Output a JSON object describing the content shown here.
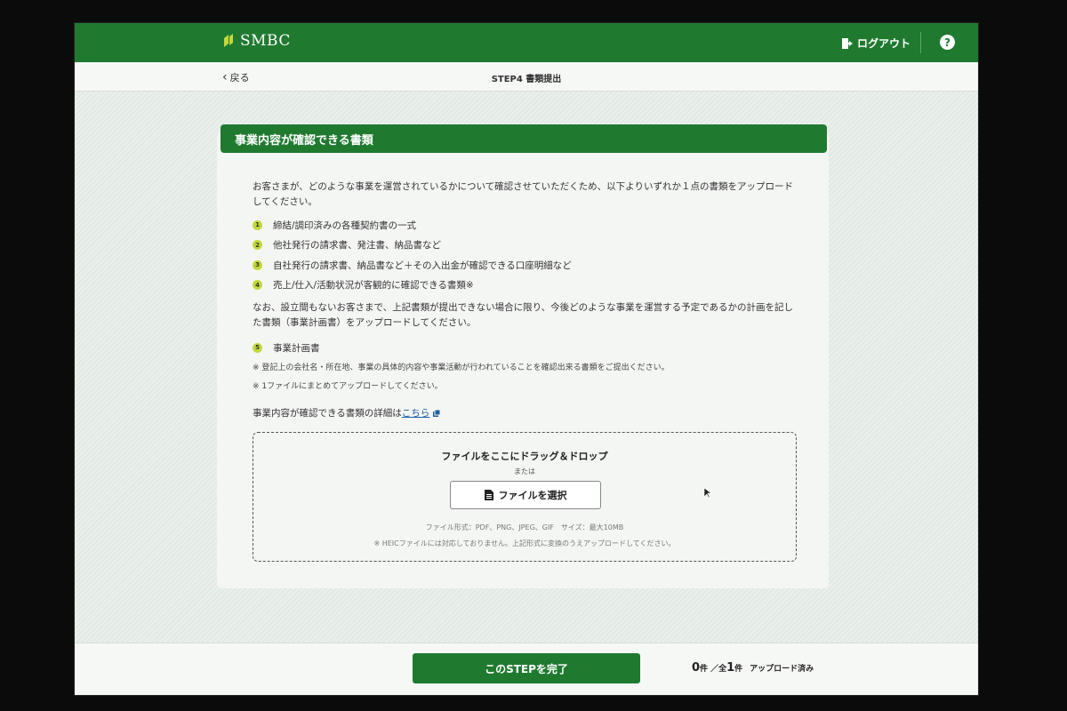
{
  "header": {
    "brand": "SMBC",
    "logout_label": "ログアウト",
    "help_label": "?"
  },
  "subheader": {
    "back_label": "戻る",
    "step_title": "STEP4  書類提出"
  },
  "card": {
    "title": "事業内容が確認できる書類",
    "intro": "お客さまが、どのような事業を運営されているかについて確認させていただくため、以下よりいずれか１点の書類をアップロードしてください。",
    "items": [
      {
        "num": "1",
        "label": "締結/調印済みの各種契約書の一式"
      },
      {
        "num": "2",
        "label": "他社発行の請求書、発注書、納品書など"
      },
      {
        "num": "3",
        "label": "自社発行の請求書、納品書など＋その入出金が確認できる口座明細など"
      },
      {
        "num": "4",
        "label": "売上/仕入/活動状況が客観的に確認できる書類※"
      }
    ],
    "note_paragraph": "なお、設立間もないお客さまで、上記書類が提出できない場合に限り、今後どのような事業を運営する予定であるかの計画を記した書類（事業計画書）をアップロードしてください。",
    "plan_item": {
      "num": "5",
      "label": "事業計画書"
    },
    "note1": "※ 登記上の会社名・所在地、事業の具体的内容や事業活動が行われていることを確認出来る書類をご提出ください。",
    "note2": "※ 1ファイルにまとめてアップロードしてください。",
    "details_prefix": "事業内容が確認できる書類の詳細は",
    "details_link": "こちら"
  },
  "dropzone": {
    "title": "ファイルをここにドラッグ＆ドロップ",
    "or": "または",
    "select_button": "ファイルを選択",
    "formats": "ファイル形式：PDF、PNG、JPEG、GIF　サイズ：最大10MB",
    "heic_note": "※ HEICファイルには対応しておりません。上記形式に変換のうえアップロードしてください。"
  },
  "footer": {
    "complete_button": "このSTEPを完了",
    "uploaded_count": "0",
    "count_unit": "件",
    "separator": "／",
    "total_prefix": "全",
    "total_count": "1",
    "uploaded_label": "アップロード済み"
  },
  "colors": {
    "brand_green": "#1f7a30",
    "badge_lime": "#c4d83a",
    "link_blue": "#1f5fa8"
  }
}
